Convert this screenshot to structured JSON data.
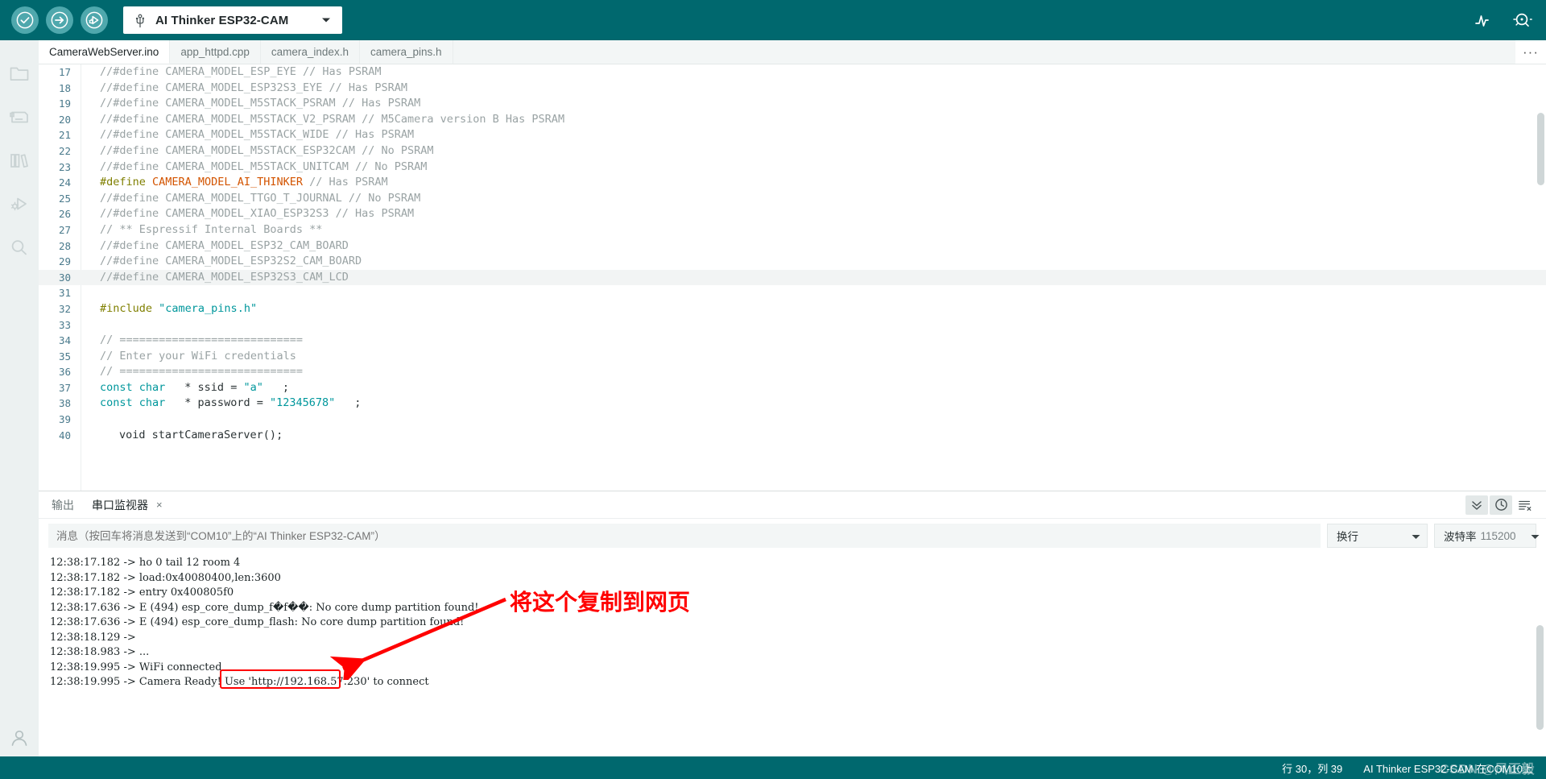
{
  "toolbar": {
    "verify_label": "verify-check",
    "upload_label": "upload-arrow",
    "debug_label": "debug-upload",
    "board": "AI Thinker ESP32-CAM",
    "plotter_icon": "serial-plotter-icon",
    "monitor_icon": "serial-monitor-icon",
    "accent": "#00686E",
    "btn_circle": "#4FA8AD"
  },
  "sidebar": {
    "items": [
      {
        "name": "sketchbook",
        "icon": "folder-icon"
      },
      {
        "name": "boards-manager",
        "icon": "board-icon"
      },
      {
        "name": "library-manager",
        "icon": "books-icon"
      },
      {
        "name": "debug",
        "icon": "debug-icon"
      },
      {
        "name": "search",
        "icon": "search-icon"
      }
    ],
    "bottom": {
      "name": "account",
      "icon": "person-icon"
    }
  },
  "tabs": {
    "items": [
      {
        "label": "CameraWebServer.ino",
        "active": true
      },
      {
        "label": "app_httpd.cpp",
        "active": false
      },
      {
        "label": "camera_index.h",
        "active": false
      },
      {
        "label": "camera_pins.h",
        "active": false
      }
    ],
    "more_label": "···"
  },
  "editor": {
    "highlight_line": 30,
    "lines": [
      {
        "n": 17,
        "segs": [
          {
            "t": "//#define CAMERA_MODEL_ESP_EYE // Has PSRAM",
            "c": "cm"
          }
        ]
      },
      {
        "n": 18,
        "segs": [
          {
            "t": "//#define CAMERA_MODEL_ESP32S3_EYE // Has PSRAM",
            "c": "cm"
          }
        ]
      },
      {
        "n": 19,
        "segs": [
          {
            "t": "//#define CAMERA_MODEL_M5STACK_PSRAM // Has PSRAM",
            "c": "cm"
          }
        ]
      },
      {
        "n": 20,
        "segs": [
          {
            "t": "//#define CAMERA_MODEL_M5STACK_V2_PSRAM // M5Camera version B Has PSRAM",
            "c": "cm"
          }
        ]
      },
      {
        "n": 21,
        "segs": [
          {
            "t": "//#define CAMERA_MODEL_M5STACK_WIDE // Has PSRAM",
            "c": "cm"
          }
        ]
      },
      {
        "n": 22,
        "segs": [
          {
            "t": "//#define CAMERA_MODEL_M5STACK_ESP32CAM // No PSRAM",
            "c": "cm"
          }
        ]
      },
      {
        "n": 23,
        "segs": [
          {
            "t": "//#define CAMERA_MODEL_M5STACK_UNITCAM // No PSRAM",
            "c": "cm"
          }
        ]
      },
      {
        "n": 24,
        "segs": [
          {
            "t": "#define ",
            "c": "kw"
          },
          {
            "t": "CAMERA_MODEL_AI_THINKER",
            "c": "red"
          },
          {
            "t": " // Has PSRAM",
            "c": "cm"
          }
        ]
      },
      {
        "n": 25,
        "segs": [
          {
            "t": "//#define CAMERA_MODEL_TTGO_T_JOURNAL // No PSRAM",
            "c": "cm"
          }
        ]
      },
      {
        "n": 26,
        "segs": [
          {
            "t": "//#define CAMERA_MODEL_XIAO_ESP32S3 // Has PSRAM",
            "c": "cm"
          }
        ]
      },
      {
        "n": 27,
        "segs": [
          {
            "t": "// ** Espressif Internal Boards **",
            "c": "cm"
          }
        ]
      },
      {
        "n": 28,
        "segs": [
          {
            "t": "//#define CAMERA_MODEL_ESP32_CAM_BOARD",
            "c": "cm"
          }
        ]
      },
      {
        "n": 29,
        "segs": [
          {
            "t": "//#define CAMERA_MODEL_ESP32S2_CAM_BOARD",
            "c": "cm"
          }
        ]
      },
      {
        "n": 30,
        "segs": [
          {
            "t": "//#define CAMERA_MODEL_ESP32S3_CAM_LCD",
            "c": "cm"
          }
        ]
      },
      {
        "n": 31,
        "segs": [
          {
            "t": "",
            "c": "lt"
          }
        ]
      },
      {
        "n": 32,
        "segs": [
          {
            "t": "#include ",
            "c": "kw"
          },
          {
            "t": "\"camera_pins.h\"",
            "c": "str"
          }
        ]
      },
      {
        "n": 33,
        "segs": [
          {
            "t": "",
            "c": "lt"
          }
        ]
      },
      {
        "n": 34,
        "segs": [
          {
            "t": "// ============================",
            "c": "cm"
          }
        ]
      },
      {
        "n": 35,
        "segs": [
          {
            "t": "// Enter your WiFi credentials",
            "c": "cm"
          }
        ]
      },
      {
        "n": 36,
        "segs": [
          {
            "t": "// ============================",
            "c": "cm"
          }
        ]
      },
      {
        "n": 37,
        "segs": [
          {
            "t": "const ",
            "c": "kw2"
          },
          {
            "t": "char",
            "c": "kw2"
          },
          {
            "t": "* ssid = ",
            "c": "lt"
          },
          {
            "t": "\"a\"",
            "c": "str"
          },
          {
            "t": ";",
            "c": "lt"
          }
        ]
      },
      {
        "n": 38,
        "segs": [
          {
            "t": "const ",
            "c": "kw2"
          },
          {
            "t": "char",
            "c": "kw2"
          },
          {
            "t": "* password = ",
            "c": "lt"
          },
          {
            "t": "\"12345678\"",
            "c": "str"
          },
          {
            "t": ";",
            "c": "lt"
          }
        ]
      },
      {
        "n": 39,
        "segs": [
          {
            "t": "",
            "c": "lt"
          }
        ]
      },
      {
        "n": 40,
        "segs": [
          {
            "t": "void startCameraServer();",
            "c": "lt"
          }
        ]
      }
    ]
  },
  "panel": {
    "tabs": [
      {
        "label": "输出",
        "active": false,
        "closable": false
      },
      {
        "label": "串口监视器",
        "active": true,
        "closable": true,
        "close": "×"
      }
    ],
    "tools": [
      {
        "name": "collapse-icon",
        "selected": true
      },
      {
        "name": "timestamp-icon",
        "selected": true
      },
      {
        "name": "clear-output-icon",
        "selected": false
      }
    ],
    "message_placeholder": "消息（按回车将消息发送到“COM10”上的“AI Thinker ESP32-CAM”）",
    "message_value": "",
    "newline_label": "换行",
    "baud_label": "波特率",
    "baud_value": "115200",
    "console_lines": [
      "12:38:17.182 -> ho 0 tail 12 room 4",
      "12:38:17.182 -> load:0x40080400,len:3600",
      "12:38:17.182 -> entry 0x400805f0",
      "12:38:17.636 -> E (494) esp_core_dump_f�f��: No core dump partition found!",
      "12:38:17.636 -> E (494) esp_core_dump_flash: No core dump partition found!",
      "12:38:18.129 -> ",
      "12:38:18.983 -> ...",
      "12:38:19.995 -> WiFi connected",
      "12:38:19.995 -> Camera Ready! Use 'http://192.168.57.230' to connect"
    ]
  },
  "annotation": {
    "text": "将这个复制到网页",
    "color": "#ff0000",
    "highlighted_value": "'http://192.168.57.230'"
  },
  "statusbar": {
    "cursor": "行 30，列 39",
    "board_port": "AI Thinker ESP32-CAM 在COM10上",
    "watermark": "CSDN @凤正毅"
  }
}
